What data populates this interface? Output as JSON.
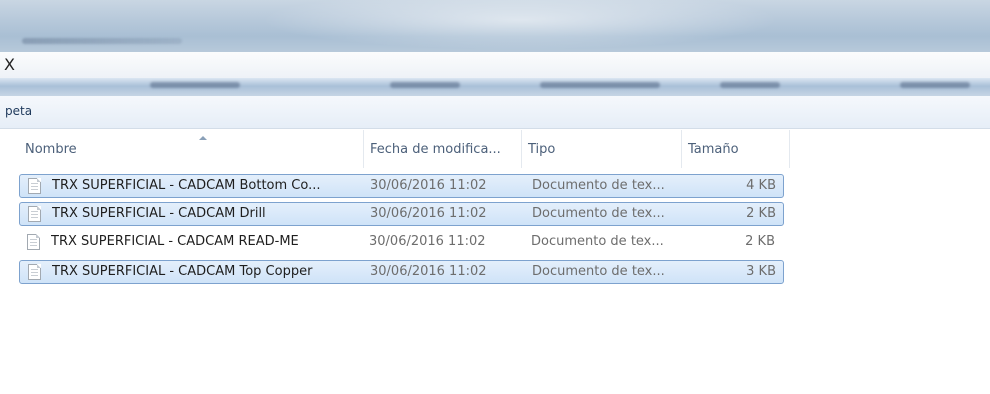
{
  "address_bar": {
    "fragment": "X"
  },
  "command_bar": {
    "label": "peta"
  },
  "columns": [
    {
      "label": "Nombre"
    },
    {
      "label": "Fecha de modifica..."
    },
    {
      "label": "Tipo"
    },
    {
      "label": "Tamaño"
    }
  ],
  "files": [
    {
      "name": "TRX SUPERFICIAL - CADCAM Bottom Co...",
      "date": "30/06/2016 11:02",
      "type": "Documento de tex...",
      "size": "4 KB",
      "selected": true
    },
    {
      "name": "TRX SUPERFICIAL - CADCAM Drill",
      "date": "30/06/2016 11:02",
      "type": "Documento de tex...",
      "size": "2 KB",
      "selected": true
    },
    {
      "name": "TRX SUPERFICIAL - CADCAM READ-ME",
      "date": "30/06/2016 11:02",
      "type": "Documento de tex...",
      "size": "2 KB",
      "selected": false
    },
    {
      "name": "TRX SUPERFICIAL - CADCAM Top Copper",
      "date": "30/06/2016 11:02",
      "type": "Documento de tex...",
      "size": "3 KB",
      "selected": true
    }
  ],
  "icons": {
    "file": "text-document-icon",
    "sort": "sort-ascending-icon"
  },
  "colors": {
    "selection_fill": "#cfe3f8",
    "selection_border": "#7da2ce",
    "header_text": "#4c607a"
  }
}
